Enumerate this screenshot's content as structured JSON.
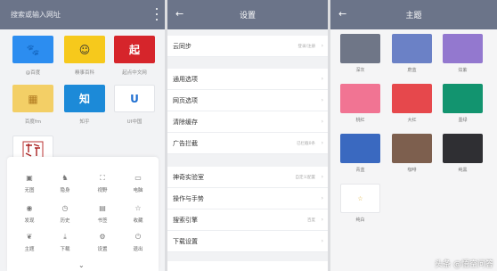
{
  "left": {
    "search_placeholder": "搜索或输入网址",
    "shortcuts": [
      {
        "label": "@百度",
        "color": "#2c8df0",
        "glyph": "🐾"
      },
      {
        "label": "糗事百科",
        "color": "#f6c91c",
        "glyph": "☺"
      },
      {
        "label": "起点中文网",
        "color": "#d6252b",
        "glyph": "起"
      },
      {
        "label": "百度fm",
        "color": "#f3cf66",
        "glyph": "▦"
      },
      {
        "label": "知乎",
        "color": "#1c8ad8",
        "glyph": "知"
      },
      {
        "label": "UI中国",
        "color": "#ffffff",
        "glyph": "U"
      }
    ],
    "menu": [
      {
        "label": "无图",
        "glyph": "▣"
      },
      {
        "label": "隐身",
        "glyph": "♞"
      },
      {
        "label": "视野",
        "glyph": "⛶"
      },
      {
        "label": "电脑",
        "glyph": "▭"
      },
      {
        "label": "发现",
        "glyph": "◉"
      },
      {
        "label": "历史",
        "glyph": "◷"
      },
      {
        "label": "书签",
        "glyph": "▤"
      },
      {
        "label": "收藏",
        "glyph": "☆"
      },
      {
        "label": "主题",
        "glyph": "❦"
      },
      {
        "label": "下载",
        "glyph": "⤓"
      },
      {
        "label": "设置",
        "glyph": "⚙"
      },
      {
        "label": "退出",
        "glyph": "⏻"
      }
    ],
    "chevron": "⌄"
  },
  "settings": {
    "title": "设置",
    "back": "←",
    "rows": [
      {
        "label": "云同步",
        "value": "登录/注册"
      },
      {
        "label": "通用选项",
        "value": ""
      },
      {
        "label": "网页选项",
        "value": ""
      },
      {
        "label": "清除缓存",
        "value": ""
      },
      {
        "label": "广告拦截",
        "value": "已拦截0条"
      },
      {
        "label": "神奇实验室",
        "value": "自定义配置"
      },
      {
        "label": "操作与手势",
        "value": ""
      },
      {
        "label": "搜索引擎",
        "value": "百度"
      },
      {
        "label": "下载设置",
        "value": ""
      }
    ]
  },
  "theme": {
    "title": "主题",
    "back": "←",
    "swatches": [
      {
        "label": "深灰",
        "color": "#6f7687"
      },
      {
        "label": "蔚蓝",
        "color": "#6b81c6"
      },
      {
        "label": "炫紫",
        "color": "#9378cf"
      },
      {
        "label": "桃红",
        "color": "#f17493"
      },
      {
        "label": "大红",
        "color": "#e6484c"
      },
      {
        "label": "墨绿",
        "color": "#12946f"
      },
      {
        "label": "青蓝",
        "color": "#3a69c0"
      },
      {
        "label": "咖啡",
        "color": "#7d5f4e"
      },
      {
        "label": "纯黑",
        "color": "#2f2f33"
      },
      {
        "label": "纯白",
        "color": "#ffffff"
      }
    ]
  },
  "watermark": "头条 @悟空问答"
}
